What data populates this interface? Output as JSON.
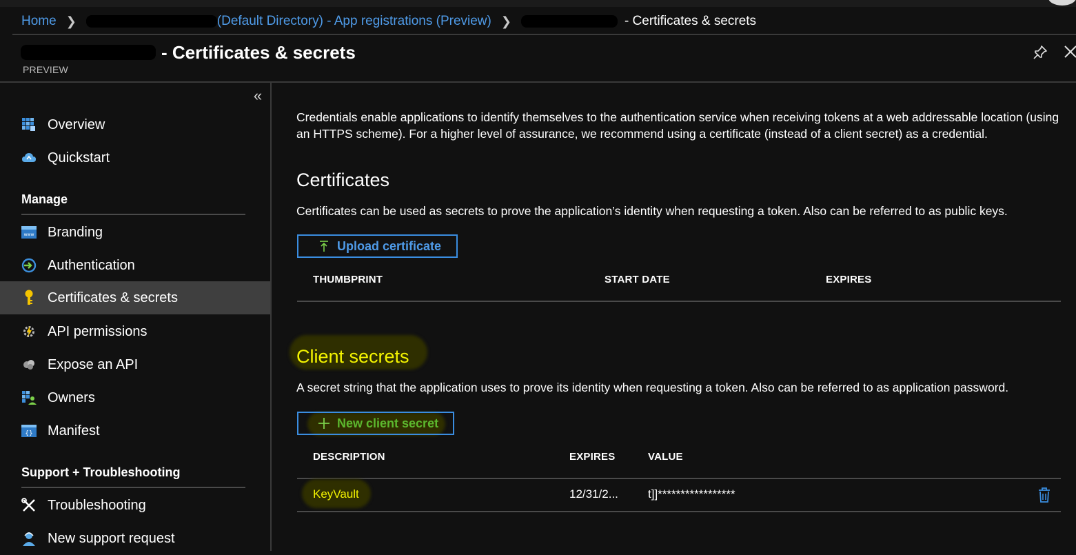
{
  "breadcrumb": {
    "home": "Home",
    "app_registrations": "(Default Directory) - App registrations (Preview)",
    "current": "- Certificates & secrets"
  },
  "header": {
    "title": "- Certificates & secrets",
    "preview": "PREVIEW"
  },
  "sidebar": {
    "items_top": [
      {
        "label": "Overview",
        "icon": "overview-grid-icon"
      },
      {
        "label": "Quickstart",
        "icon": "cloud-quickstart-icon"
      }
    ],
    "manage_heading": "Manage",
    "manage_items": [
      {
        "label": "Branding",
        "icon": "branding-www-icon"
      },
      {
        "label": "Authentication",
        "icon": "authentication-arrow-icon"
      },
      {
        "label": "Certificates & secrets",
        "icon": "key-icon",
        "active": true
      },
      {
        "label": "API permissions",
        "icon": "api-permissions-gear-icon"
      },
      {
        "label": "Expose an API",
        "icon": "expose-api-cloud-icon"
      },
      {
        "label": "Owners",
        "icon": "owners-icon"
      },
      {
        "label": "Manifest",
        "icon": "manifest-braces-icon"
      }
    ],
    "support_heading": "Support + Troubleshooting",
    "support_items": [
      {
        "label": "Troubleshooting",
        "icon": "wrench-icon"
      },
      {
        "label": "New support request",
        "icon": "support-person-icon"
      }
    ]
  },
  "main": {
    "intro": "Credentials enable applications to identify themselves to the authentication service when receiving tokens at a web addressable location (using an HTTPS scheme). For a higher level of assurance, we recommend using a certificate (instead of a client secret) as a credential.",
    "certificates": {
      "heading": "Certificates",
      "description": "Certificates can be used as secrets to prove the application’s identity when requesting a token. Also can be referred to as public keys.",
      "upload_button": "Upload certificate",
      "columns": [
        "THUMBPRINT",
        "START DATE",
        "EXPIRES"
      ]
    },
    "client_secrets": {
      "heading": "Client secrets",
      "description": "A secret string that the application uses to prove its identity when requesting a token. Also can be referred to as application password.",
      "new_button": "New client secret",
      "columns": [
        "DESCRIPTION",
        "EXPIRES",
        "VALUE"
      ],
      "rows": [
        {
          "description": "KeyVault",
          "expires": "12/31/2...",
          "value": "t]]*****************"
        }
      ]
    }
  },
  "colors": {
    "link": "#4f9be8",
    "accent_border": "#3a8de0",
    "highlight": "#f4f400",
    "green": "#5cb82e"
  }
}
